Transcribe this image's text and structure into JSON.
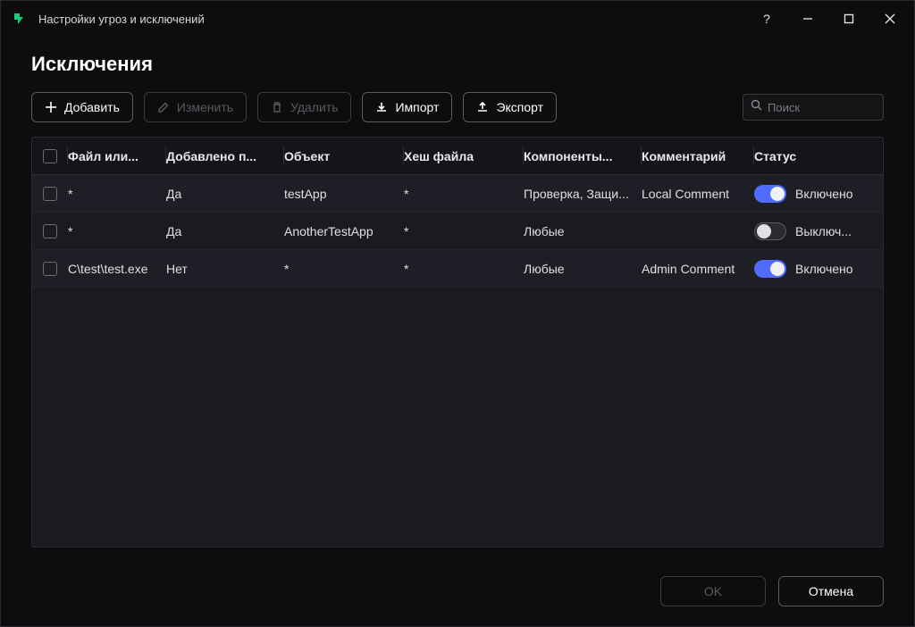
{
  "window": {
    "title": "Настройки угроз и исключений"
  },
  "page": {
    "heading": "Исключения",
    "toolbar": {
      "add": "Добавить",
      "edit": "Изменить",
      "delete": "Удалить",
      "import": "Импорт",
      "export": "Экспорт",
      "search_placeholder": "Поиск"
    },
    "columns": {
      "file": "Файл или...",
      "added": "Добавлено п...",
      "object": "Объект",
      "hash": "Хеш файла",
      "components": "Компоненты...",
      "comment": "Комментарий",
      "status": "Статус"
    },
    "rows": [
      {
        "file": "*",
        "added": "Да",
        "object": "testApp",
        "hash": "*",
        "components": "Проверка, Защи...",
        "comment": "Local Comment",
        "status_on": true,
        "status_text": "Включено"
      },
      {
        "file": "*",
        "added": "Да",
        "object": "AnotherTestApp",
        "hash": "*",
        "components": "Любые",
        "comment": "",
        "status_on": false,
        "status_text": "Выключ..."
      },
      {
        "file": "C\\test\\test.exe",
        "added": "Нет",
        "object": "*",
        "hash": "*",
        "components": "Любые",
        "comment": "Admin Comment",
        "status_on": true,
        "status_text": "Включено"
      }
    ]
  },
  "footer": {
    "ok": "OK",
    "cancel": "Отмена"
  }
}
